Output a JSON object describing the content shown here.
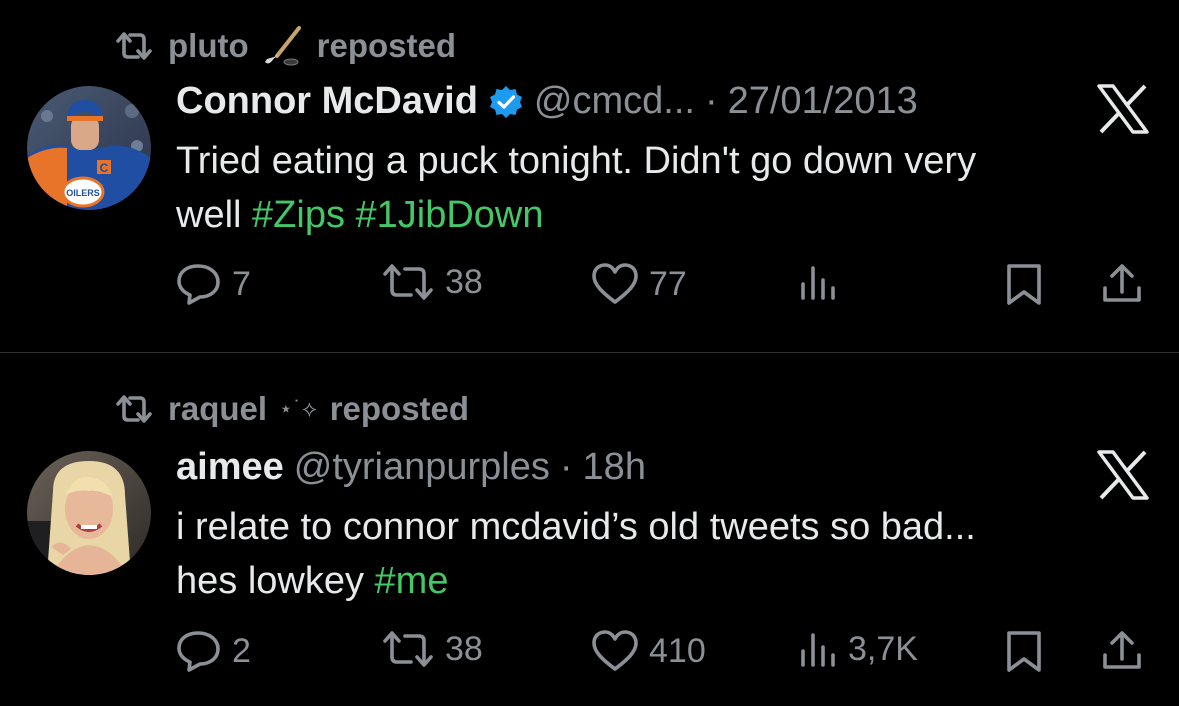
{
  "colors": {
    "background": "#000000",
    "text": "#e7e9ea",
    "muted": "#8b9096",
    "hashtag": "#44c767",
    "verified": "#1d9bf0"
  },
  "tweets": [
    {
      "reposted_by": "pluto",
      "reposted_by_emoji": "hockey-stick-icon",
      "reposted_label": "reposted",
      "author_name": "Connor McDavid",
      "verified": true,
      "handle": "@cmcd...",
      "separator": "·",
      "time": "27/01/2013",
      "text_line1": "Tried eating a puck tonight. Didn't go down very",
      "text_line2_plain": "well ",
      "hashtag1": "#Zips",
      "hashtag2": "#1JibDown",
      "reply_count": "7",
      "repost_count": "38",
      "like_count": "77",
      "view_count": ""
    },
    {
      "reposted_by": "raquel",
      "reposted_by_sparkle": "⋆˙⟡",
      "reposted_label": "reposted",
      "author_name": "aimee",
      "verified": false,
      "handle": "@tyrianpurples",
      "separator": "·",
      "time": "18h",
      "text_line1": "i relate to connor mcdavid’s old tweets so bad...",
      "text_line2_plain": "hes lowkey ",
      "hashtag1": "#me",
      "reply_count": "2",
      "repost_count": "38",
      "like_count": "410",
      "view_count": "3,7K"
    }
  ]
}
